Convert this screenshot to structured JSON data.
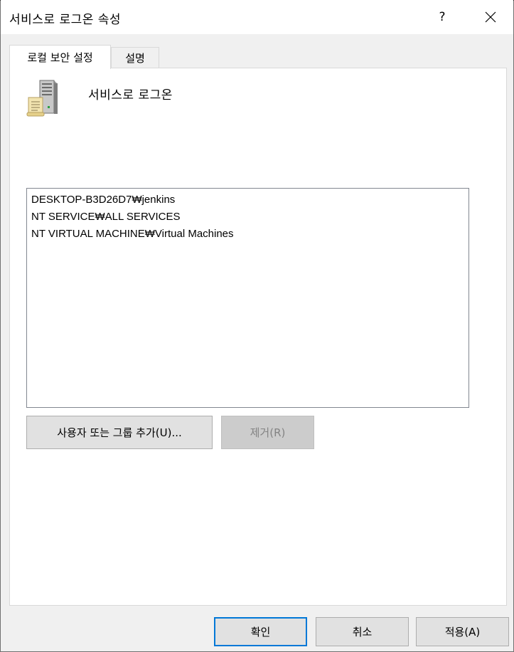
{
  "window": {
    "title": "서비스로 로그온 속성",
    "help_glyph": "?",
    "close_glyph": "close-icon"
  },
  "tabs": [
    {
      "label": "로컬 보안 설정",
      "active": true
    },
    {
      "label": "설명",
      "active": false
    }
  ],
  "policy": {
    "icon": "server-icon",
    "name": "서비스로 로그온"
  },
  "accounts": [
    "DESKTOP-B3D26D7₩jenkins",
    "NT SERVICE₩ALL SERVICES",
    "NT VIRTUAL MACHINE₩Virtual Machines"
  ],
  "buttons": {
    "add": "사용자 또는 그룹 추가(U)...",
    "remove": "제거(R)",
    "ok": "확인",
    "cancel": "취소",
    "apply": "적용(A)"
  },
  "colors": {
    "accent": "#0078d7",
    "panel_bg": "#ffffff",
    "window_bg": "#f0f0f0",
    "disabled_text": "#838383"
  }
}
